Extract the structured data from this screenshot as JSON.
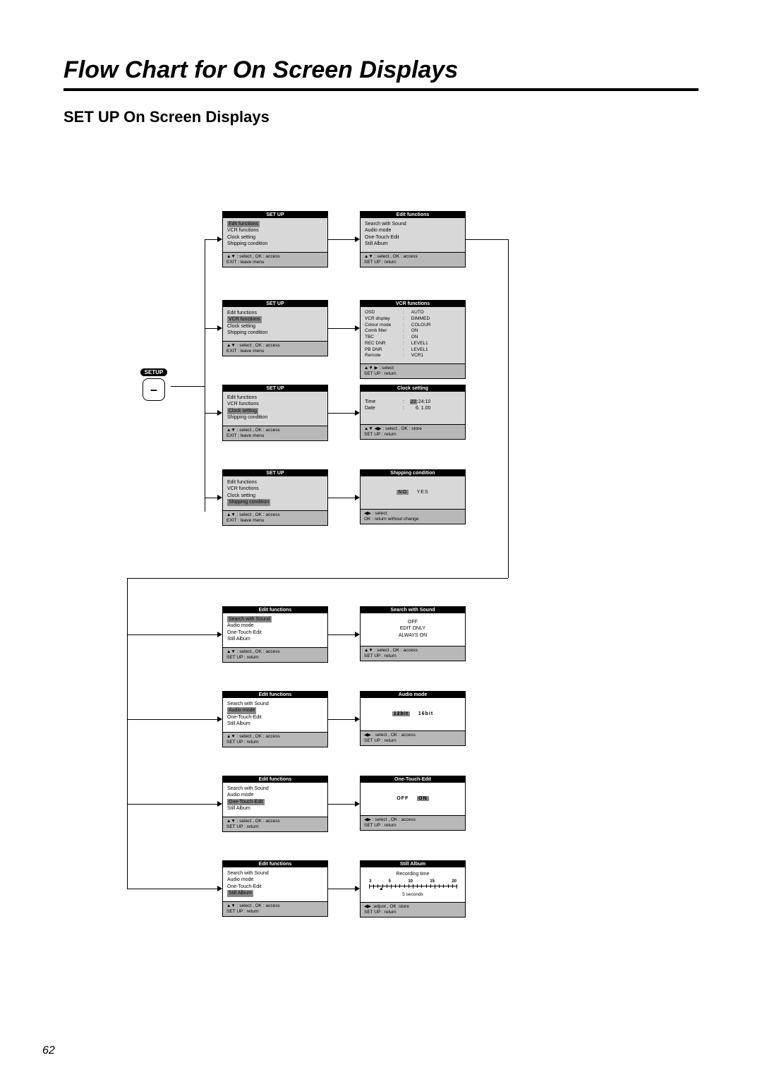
{
  "page_title": "Flow Chart for On Screen Displays",
  "section_title": "SET UP On Screen Displays",
  "page_number": "62",
  "setup_label": "SETUP",
  "setup_glyph": "–",
  "footers": {
    "select_ok_exit": "▲▼ : select  ,   OK : access\nEXIT : leave menu",
    "select_ok_setup": "▲▼ : select  ,   OK : access\nSET UP : return",
    "select_right_setup": "▲▼ ▶ : select\nSET UP : return",
    "select4_ok_setup": "▲▼ ◀▶  : select ,  OK : store\nSET UP : return",
    "lr_select_ok": "◀▶ : select\nOK : return without change",
    "lr_select_ok_setup": "◀▶  : select ,  OK : access\nSET UP : return",
    "lr_adjust_ok_setup": "◀▶  :adjust ,  OK :store\nSET UP : return"
  },
  "setup_menu": {
    "title": "SET   UP",
    "items": [
      "Edit functions",
      "VCR functions",
      "Clock setting",
      "Shipping condition"
    ]
  },
  "edit_menu": {
    "title": "Edit functions",
    "items": [
      "Search with Sound",
      "Audio mode",
      "One-Touch-Edit",
      "Still Album"
    ]
  },
  "vcr_menu": {
    "title": "VCR functions",
    "rows": [
      {
        "k": "OSD",
        "v": "AUTO",
        "sel": true
      },
      {
        "k": "VCR display",
        "v": "DIMMED"
      },
      {
        "k": "Colour mode",
        "v": "COLOUR"
      },
      {
        "k": "Comb filter",
        "v": "ON"
      },
      {
        "k": "TBC",
        "v": "ON"
      },
      {
        "k": "REC DNR",
        "v": "LEVEL1"
      },
      {
        "k": "PB DNR",
        "v": "LEVEL1"
      },
      {
        "k": "Remote",
        "v": "VCR1"
      }
    ]
  },
  "clock_menu": {
    "title": "Clock setting",
    "time_k": "Time",
    "time_v": "22",
    "time_rest": ":24:10",
    "date_k": "Date",
    "date_v": "6.  1.00"
  },
  "ship_menu": {
    "title": "Shipping condition",
    "opts": [
      "NO",
      "YES"
    ],
    "sel": 0
  },
  "search_menu": {
    "title": "Search with Sound",
    "opts": [
      "OFF",
      "EDIT ONLY",
      "ALWAYS ON"
    ],
    "sel": 1
  },
  "audio_menu": {
    "title": "Audio mode",
    "opts": [
      "12bit",
      "16bit"
    ],
    "sel": 0,
    "bold": true
  },
  "ote_menu": {
    "title": "One-Touch-Edit",
    "opts": [
      "OFF",
      "ON"
    ],
    "sel": 1,
    "bold": true
  },
  "still_menu": {
    "title": "Still Album",
    "label": "Recording time",
    "ticks": [
      "3",
      "5",
      "10",
      "15",
      "20"
    ],
    "value_label": "5 seconds"
  }
}
